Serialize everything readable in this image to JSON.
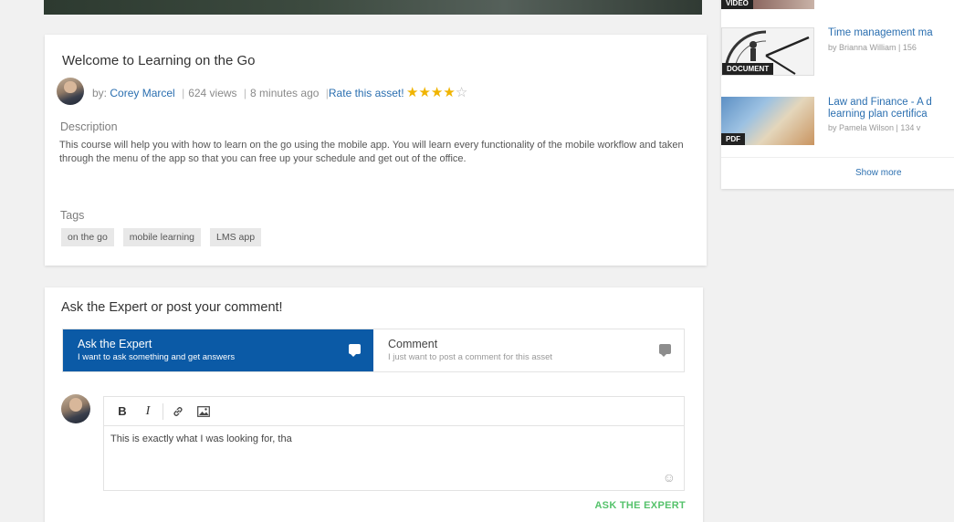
{
  "asset": {
    "title": "Welcome to Learning on the Go",
    "by_label": "by:",
    "author": "Corey Marcel",
    "views": "624 views",
    "time_ago": "8 minutes ago",
    "rate_link": "Rate this asset!",
    "rating": 4,
    "rating_max": 5,
    "description_label": "Description",
    "description": "This course will help you with how to learn on the go using the mobile app. You will learn every functionality of the mobile workflow and taken through the menu of the app so that you can free up your schedule and get out of the office.",
    "tags_label": "Tags",
    "tags": [
      "on the go",
      "mobile learning",
      "LMS app"
    ]
  },
  "comment": {
    "heading": "Ask the Expert or post your comment!",
    "tabs": [
      {
        "title": "Ask the Expert",
        "subtitle": "I want to ask something and get answers",
        "active": true
      },
      {
        "title": "Comment",
        "subtitle": "I just  want to post a comment for this asset",
        "active": false
      }
    ],
    "toolbar": {
      "bold": "B",
      "italic": "I"
    },
    "draft_text": "This is exactly what I was looking for, tha",
    "submit_label": "ASK THE EXPERT"
  },
  "sidebar": {
    "items": [
      {
        "badge": "VIDEO",
        "title": "",
        "meta": ""
      },
      {
        "badge": "DOCUMENT",
        "title": "Time management ma",
        "meta": "by Brianna William  |  156"
      },
      {
        "badge": "PDF",
        "title_line1": "Law and Finance - A d",
        "title_line2": "learning plan certifica",
        "meta": "by Pamela Wilson  |  134 v"
      }
    ],
    "show_more": "Show more"
  },
  "colors": {
    "accent": "#0b5aa6",
    "link": "#2b6fb0",
    "submit": "#55c26b",
    "star": "#f0b400"
  }
}
